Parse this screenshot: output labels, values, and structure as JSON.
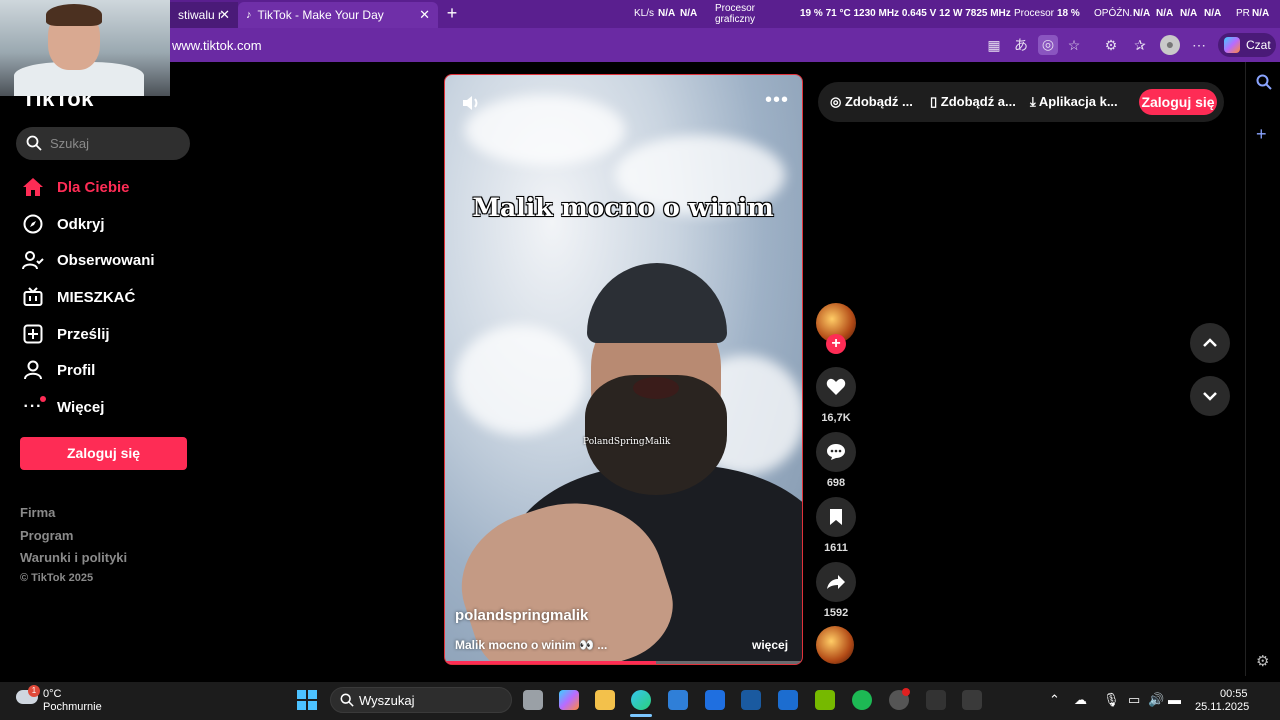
{
  "browser": {
    "tabs": [
      {
        "label": "stiwalu r"
      },
      {
        "label": "TikTok - Make Your Day"
      }
    ],
    "url": "www.tiktok.com",
    "copilot_label": "Czat"
  },
  "hw_monitor": {
    "kb_label": "KL/s",
    "kb_values": [
      "N/A",
      "N/A"
    ],
    "gpu_label_1": "Procesor",
    "gpu_label_2": "graficzny",
    "gpu_stats": "19 % 71 °C 1230 MHz 0.645 V 12 W 7825 MHz",
    "cpu_label": "Procesor",
    "cpu_value": "18 %",
    "lat_label": "OPÓŹN.",
    "lat_values": [
      "N/A",
      "N/A",
      "N/A",
      "N/A"
    ],
    "pr_label": "PR",
    "pr_value": "N/A"
  },
  "sidebar": {
    "logo": "TikTok",
    "search_placeholder": "Szukaj",
    "items": [
      {
        "label": "Dla Ciebie",
        "icon": "home-icon"
      },
      {
        "label": "Odkryj",
        "icon": "compass-icon"
      },
      {
        "label": "Obserwowani",
        "icon": "following-icon"
      },
      {
        "label": "MIESZKAĆ",
        "icon": "live-icon"
      },
      {
        "label": "Prześlij",
        "icon": "upload-icon"
      },
      {
        "label": "Profil",
        "icon": "profile-icon"
      },
      {
        "label": "Więcej",
        "icon": "more-icon"
      }
    ],
    "login_label": "Zaloguj się",
    "footer": [
      "Firma",
      "Program",
      "Warunki i polityki"
    ],
    "copyright": "© TikTok 2025"
  },
  "video": {
    "overlay_title": "Malik mocno o winim",
    "watermark": "PolandSpringMalik",
    "username": "polandspringmalik",
    "description": "Malik mocno o winim 👀 ...",
    "more_label": "więcej",
    "progress": 0.59
  },
  "actions": {
    "likes": "16,7K",
    "comments": "698",
    "saves": "1611",
    "shares": "1592"
  },
  "toppill": {
    "items": [
      "Zdobądź ...",
      "Zdobądź a...",
      "Aplikacja k..."
    ],
    "login_label": "Zaloguj się"
  },
  "taskbar": {
    "temp": "0°C",
    "condition": "Pochmurnie",
    "weather_badge": "1",
    "search_label": "Wyszukaj",
    "time": "00:55",
    "date": "25.11.2025"
  },
  "colors": {
    "accent": "#fe2c55",
    "browser": "#6a2aa3"
  }
}
